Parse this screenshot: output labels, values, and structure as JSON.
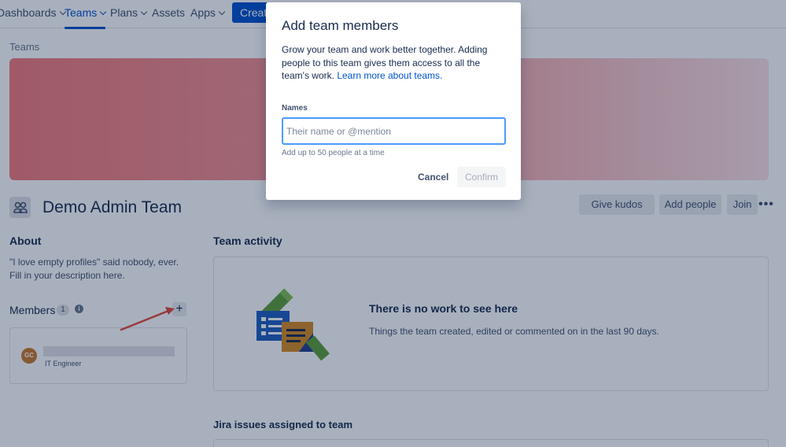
{
  "nav": {
    "dashboards": "Dashboards",
    "teams": "Teams",
    "plans": "Plans",
    "assets": "Assets",
    "apps": "Apps",
    "create": "Create"
  },
  "breadcrumb": "Teams",
  "team": {
    "title": "Demo Admin Team",
    "give_kudos": "Give kudos",
    "add_people": "Add people",
    "join": "Join",
    "more": "•••"
  },
  "about": {
    "heading": "About",
    "text": "\"I love empty profiles\" said nobody, ever. Fill in your description here."
  },
  "members": {
    "heading": "Members",
    "count": "1",
    "add": "+",
    "list": [
      {
        "initials": "GC",
        "role": "IT Engineer"
      }
    ]
  },
  "activity": {
    "heading": "Team activity",
    "title": "There is no work to see here",
    "subtitle": "Things the team created, edited or commented on in the last 90 days."
  },
  "jira": {
    "heading": "Jira issues assigned to team"
  },
  "modal": {
    "title": "Add team members",
    "desc": "Grow your team and work better together. Adding people to this team gives them access to all the team's work. ",
    "learn_more": "Learn more about teams.",
    "names_label": "Names",
    "placeholder": "Their name or @mention",
    "help": "Add up to 50 people at a time",
    "cancel": "Cancel",
    "confirm": "Confirm"
  },
  "colors": {
    "primary": "#0052cc",
    "focus": "#4c9aff",
    "banner_start": "#f27b7b",
    "banner_end": "#fbe1e4",
    "avatar": "#c97a2c",
    "arrow": "#e5493a"
  }
}
